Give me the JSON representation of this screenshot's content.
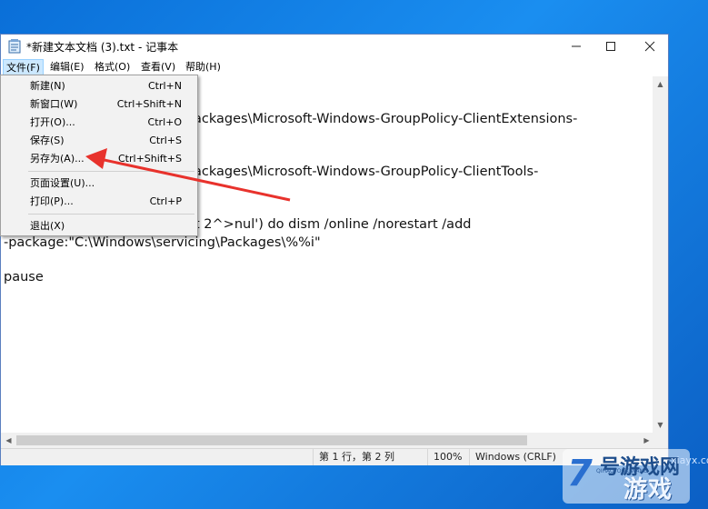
{
  "window": {
    "title": "*新建文本文档 (3).txt - 记事本",
    "minimize_glyph": "—",
    "maximize_glyph": "☐",
    "close_glyph": "✕"
  },
  "menubar": {
    "items": [
      {
        "label": "文件(F)"
      },
      {
        "label": "编辑(E)"
      },
      {
        "label": "格式(O)"
      },
      {
        "label": "查看(V)"
      },
      {
        "label": "帮助(H)"
      }
    ]
  },
  "file_menu": {
    "items": [
      {
        "label": "新建(N)",
        "shortcut": "Ctrl+N"
      },
      {
        "label": "新窗口(W)",
        "shortcut": "Ctrl+Shift+N"
      },
      {
        "label": "打开(O)...",
        "shortcut": "Ctrl+O"
      },
      {
        "label": "保存(S)",
        "shortcut": "Ctrl+S"
      },
      {
        "label": "另存为(A)...",
        "shortcut": "Ctrl+Shift+S"
      },
      {
        "label": "页面设置(U)...",
        "shortcut": ""
      },
      {
        "label": "打印(P)...",
        "shortcut": "Ctrl+P"
      },
      {
        "label": "退出(X)",
        "shortcut": ""
      }
    ]
  },
  "editor": {
    "lines": [
      "ackages\\Microsoft-Windows-GroupPolicy-ClientExtensions-",
      "ackages\\Microsoft-Windows-GroupPolicy-ClientTools-",
      "t 2^>nul') do dism /online /norestart /add",
      "-package:\"C:\\Windows\\servicing\\Packages\\%%i\"",
      "pause"
    ]
  },
  "statusbar": {
    "position": "第 1 行，第 2 列",
    "zoom": "100%",
    "line_ending": "Windows (CRLF)"
  },
  "watermark": {
    "brand_top": "号游戏网",
    "brand_small": "QIHAOYOUXIWANG",
    "brand_big": "游戏",
    "site": "xiayx.com"
  },
  "colors": {
    "arrow": "#e8322c",
    "menu_highlight": "#cce8ff",
    "desktop": "#1a8ef0"
  }
}
